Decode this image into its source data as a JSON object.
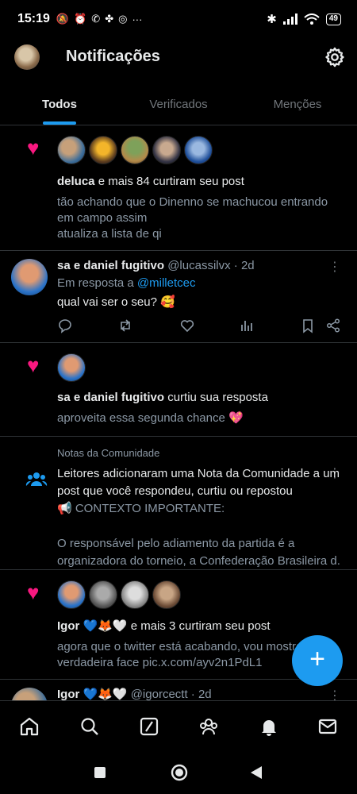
{
  "status_bar": {
    "time": "15:19",
    "battery": "49"
  },
  "header": {
    "title": "Notificações"
  },
  "tabs": [
    {
      "label": "Todos",
      "active": true
    },
    {
      "label": "Verificados",
      "active": false
    },
    {
      "label": "Menções",
      "active": false
    }
  ],
  "notifications": [
    {
      "type": "like",
      "actor": "deluca",
      "action": " e mais 84 curtiram seu post",
      "snippet_lines": [
        "tão achando que o Dinenno se machucou entrando",
        "em campo assim",
        "atualiza a lista de qi"
      ]
    },
    {
      "type": "reply",
      "name": "sa e daniel fugitivo",
      "handle": "@lucassilvx",
      "time": "· 2d",
      "reply_prefix": "Em resposta a ",
      "reply_to": "@milletcec",
      "text": "qual vai ser o seu? 🥰"
    },
    {
      "type": "like",
      "actor": "sa e daniel fugitivo",
      "action": " curtiu sua resposta",
      "snippet_lines": [
        "aproveita essa segunda chance 💖"
      ]
    },
    {
      "type": "community_note",
      "label": "Notas da Comunidade",
      "lines": [
        "Leitores adicionaram uma Nota da Comunidade a um",
        "post que você respondeu, curtiu ou repostou",
        "📢 CONTEXTO IMPORTANTE:",
        "",
        "O responsável pelo adiamento da partida é a",
        "organizadora do torneio, a Confederação Brasileira d..."
      ]
    },
    {
      "type": "like",
      "actor": "Igor 💙🦊🤍",
      "action": " e mais 3 curtiram seu post",
      "snippet_lines": [
        "agora que o twitter está acabando, vou mostrar a",
        "verdadeira face pic.x.com/ayv2n1PdL1"
      ]
    },
    {
      "type": "post",
      "name": "Igor 💙🦊🤍",
      "handle": "@igorcectt",
      "time": "· 2d"
    }
  ],
  "fab": {
    "label": "+"
  },
  "colors": {
    "accent": "#1d9bf0",
    "like": "#f91880",
    "background": "#000000"
  }
}
